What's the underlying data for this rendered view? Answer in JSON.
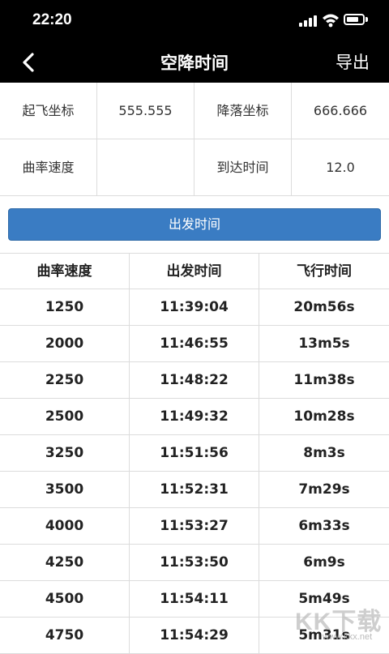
{
  "status_bar": {
    "time": "22:20"
  },
  "nav": {
    "title": "空降时间",
    "export_label": "导出"
  },
  "info": {
    "takeoff_label": "起飞坐标",
    "takeoff_value": "555.555",
    "landing_label": "降落坐标",
    "landing_value": "666.666",
    "curve_label": "曲率速度",
    "curve_value": "",
    "arrival_label": "到达时间",
    "arrival_value": "12.0"
  },
  "depart_button": "出发时间",
  "table": {
    "headers": [
      "曲率速度",
      "出发时间",
      "飞行时间"
    ],
    "rows": [
      [
        "1250",
        "11:39:04",
        "20m56s"
      ],
      [
        "2000",
        "11:46:55",
        "13m5s"
      ],
      [
        "2250",
        "11:48:22",
        "11m38s"
      ],
      [
        "2500",
        "11:49:32",
        "10m28s"
      ],
      [
        "3250",
        "11:51:56",
        "8m3s"
      ],
      [
        "3500",
        "11:52:31",
        "7m29s"
      ],
      [
        "4000",
        "11:53:27",
        "6m33s"
      ],
      [
        "4250",
        "11:53:50",
        "6m9s"
      ],
      [
        "4500",
        "11:54:11",
        "5m49s"
      ],
      [
        "4750",
        "11:54:29",
        "5m31s"
      ]
    ]
  },
  "watermark": {
    "logo": "KK下载",
    "url": "www.kkx.net"
  },
  "colors": {
    "header_bg": "#000000",
    "button_bg": "#3a7cc3",
    "border": "#dcdcdc"
  }
}
